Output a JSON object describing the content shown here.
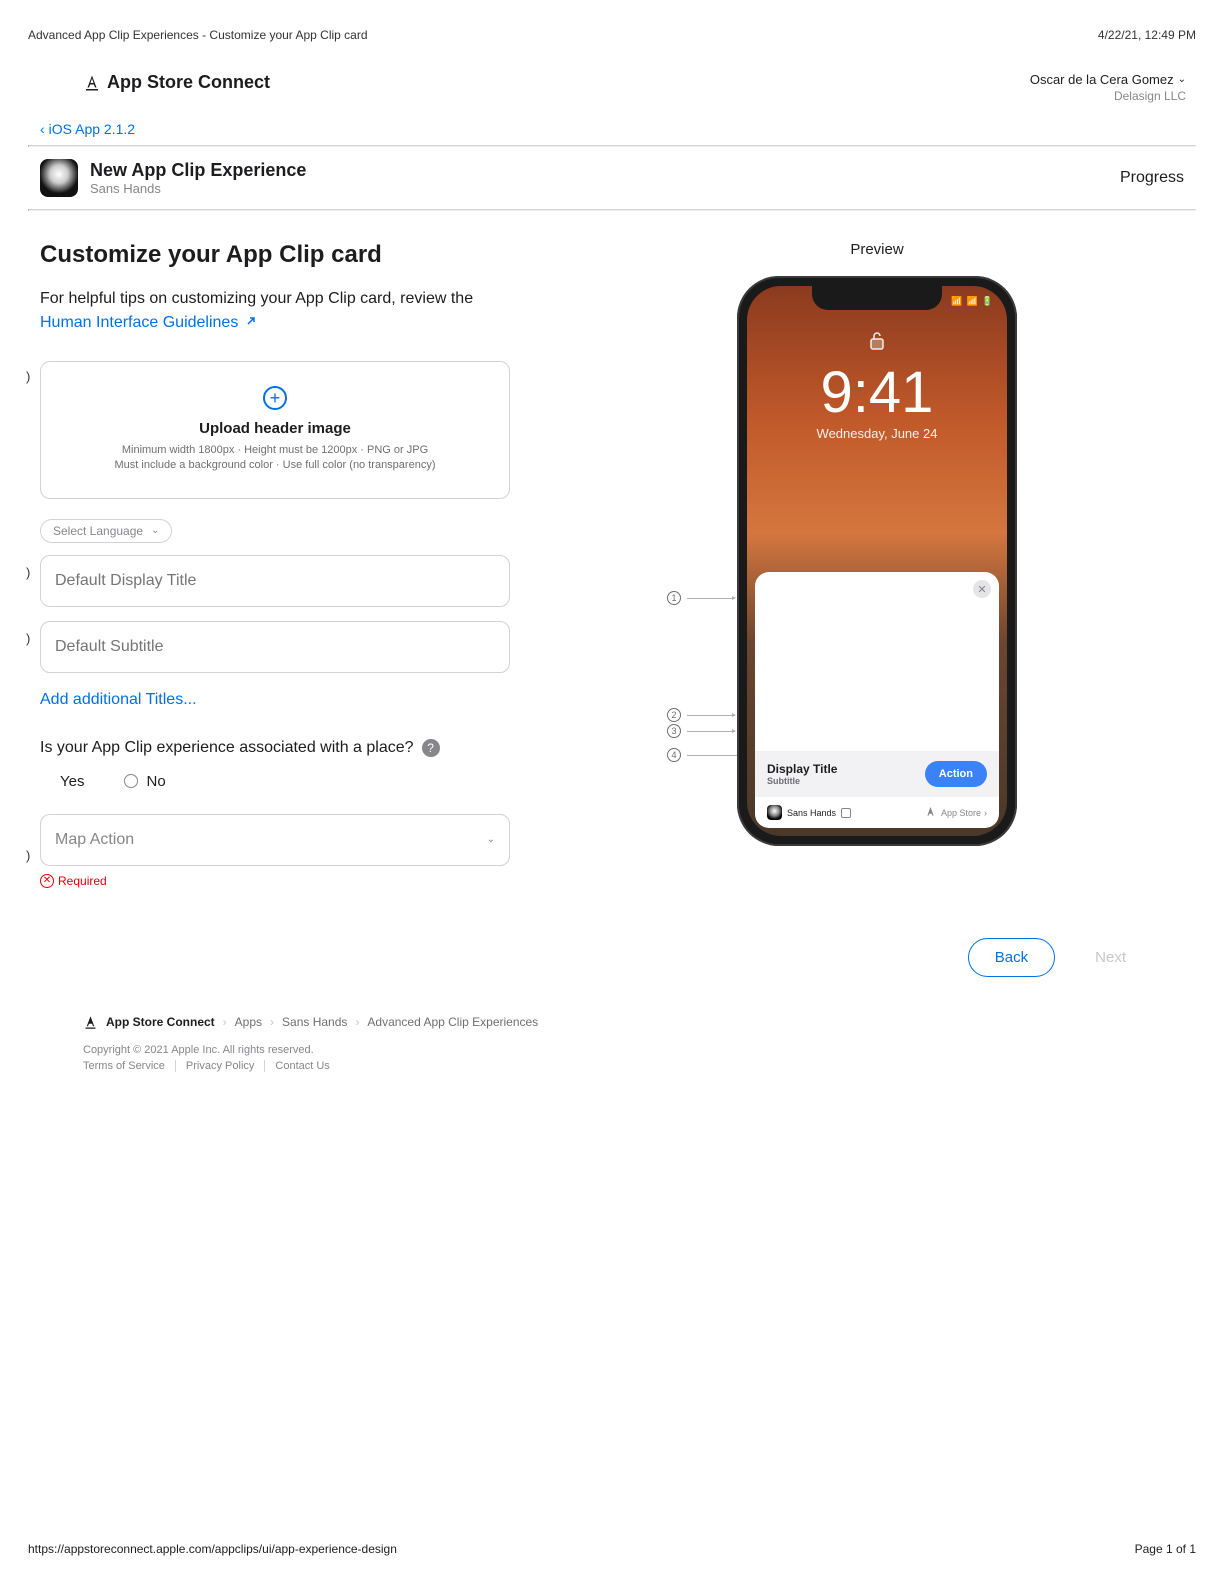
{
  "print": {
    "title": "Advanced App Clip Experiences - Customize your App Clip card",
    "timestamp": "4/22/21, 12:49 PM",
    "url": "https://appstoreconnect.apple.com/appclips/ui/app-experience-design",
    "page": "Page 1 of 1"
  },
  "header": {
    "brand": "App Store Connect",
    "user_name": "Oscar de la Cera Gomez",
    "org": "Delasign LLC",
    "back_label": "iOS App 2.1.2"
  },
  "app": {
    "title": "New App Clip Experience",
    "subtitle": "Sans Hands",
    "progress": "Progress"
  },
  "form": {
    "section_title": "Customize your App Clip card",
    "tips_text": "For helpful tips on customizing your App Clip card, review the",
    "hig_link": "Human Interface Guidelines",
    "upload_title": "Upload header image",
    "upload_hint1": "Minimum width 1800px · Height must be 1200px · PNG or JPG",
    "upload_hint2": "Must include a background color · Use full color (no transparency)",
    "lang_placeholder": "Select Language",
    "title_placeholder": "Default Display Title",
    "subtitle_placeholder": "Default Subtitle",
    "add_titles": "Add additional Titles...",
    "place_question": "Is your App Clip experience associated with a place?",
    "yes": "Yes",
    "no": "No",
    "map_action": "Map Action",
    "required": "Required"
  },
  "preview": {
    "label": "Preview",
    "time": "9:41",
    "date": "Wednesday, June 24",
    "card_title": "Display Title",
    "card_subtitle": "Subtitle",
    "action": "Action",
    "app_name": "Sans Hands",
    "store": "App Store"
  },
  "nav": {
    "back": "Back",
    "next": "Next"
  },
  "footer": {
    "crumb_asc": "App Store Connect",
    "crumb_apps": "Apps",
    "crumb_app": "Sans Hands",
    "crumb_page": "Advanced App Clip Experiences",
    "copyright": "Copyright © 2021 Apple Inc. All rights reserved.",
    "tos": "Terms of Service",
    "privacy": "Privacy Policy",
    "contact": "Contact Us"
  }
}
